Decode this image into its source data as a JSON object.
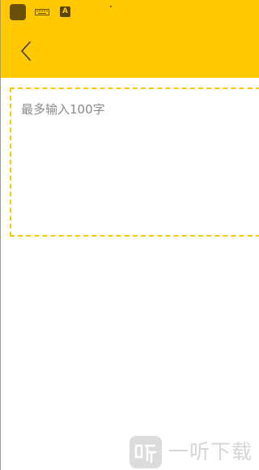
{
  "status_bar": {
    "icons": [
      "app-icon",
      "keyboard-icon",
      "input-method-a-icon"
    ],
    "a_icon_letter": "A"
  },
  "header": {
    "back_icon": "chevron-left-icon",
    "accent_color": "#ffc800"
  },
  "input": {
    "placeholder": "最多输入100字",
    "value": "",
    "border_color": "#ffc800"
  },
  "watermark": {
    "logo": "yiting-logo",
    "text": "一听下载"
  }
}
